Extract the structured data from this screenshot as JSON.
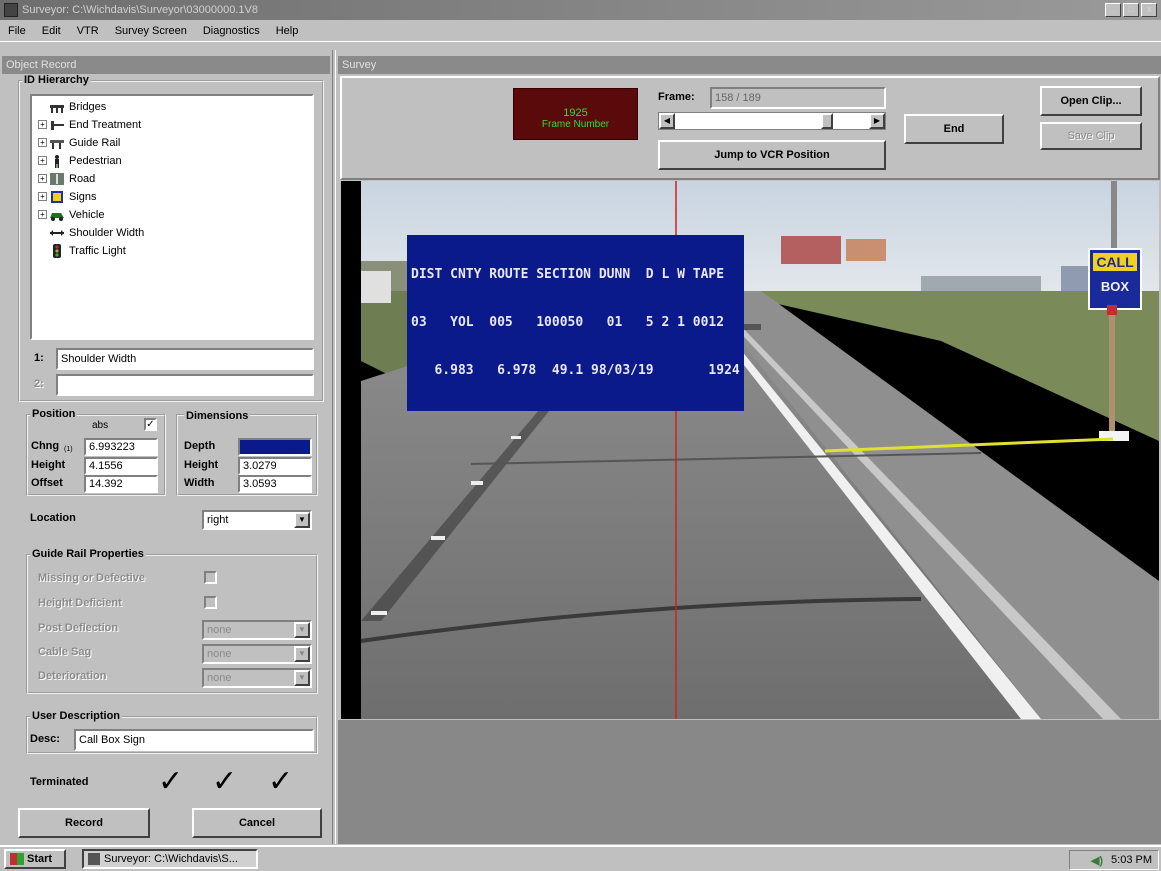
{
  "window": {
    "title": "Surveyor: C:\\Wichdavis\\Surveyor\\03000000.1V8",
    "min_label": "_",
    "max_label": "□",
    "close_label": "x"
  },
  "menu": [
    "File",
    "Edit",
    "VTR",
    "Survey Screen",
    "Diagnostics",
    "Help"
  ],
  "object_record": {
    "panel_title": "Object Record",
    "hierarchy_label": "ID Hierarchy",
    "tree": [
      {
        "expand": "",
        "icon": "bridge-icon",
        "label": "Bridges"
      },
      {
        "expand": "+",
        "icon": "end-treatment-icon",
        "label": "End Treatment"
      },
      {
        "expand": "+",
        "icon": "guide-rail-icon",
        "label": "Guide Rail"
      },
      {
        "expand": "+",
        "icon": "pedestrian-icon",
        "label": "Pedestrian"
      },
      {
        "expand": "+",
        "icon": "road-icon",
        "label": "Road"
      },
      {
        "expand": "+",
        "icon": "signs-icon",
        "label": "Signs"
      },
      {
        "expand": "+",
        "icon": "vehicle-icon",
        "label": "Vehicle"
      },
      {
        "expand": "",
        "icon": "shoulder-width-icon",
        "label": "Shoulder Width"
      },
      {
        "expand": "",
        "icon": "traffic-light-icon",
        "label": "Traffic Light"
      }
    ],
    "field1_label": "1:",
    "field1_value": "Shoulder Width",
    "field2_label": "2:",
    "field2_value": "",
    "position": {
      "title": "Position",
      "abs_label": "abs",
      "abs_checked": "✓",
      "chng_label": "Chng",
      "chng_sub": "(1)",
      "chng_value": "6.993223",
      "height_label": "Height",
      "height_value": "4.1556",
      "offset_label": "Offset",
      "offset_value": "14.392"
    },
    "dimensions": {
      "title": "Dimensions",
      "depth_label": "Depth",
      "depth_value": "",
      "height_label": "Height",
      "height_value": "3.0279",
      "width_label": "Width",
      "width_value": "3.0593"
    },
    "location_label": "Location",
    "location_value": "right",
    "guide_rail": {
      "title": "Guide Rail Properties",
      "missing_label": "Missing or Defective",
      "height_def_label": "Height Deficient",
      "post_def_label": "Post Deflection",
      "post_def_value": "none",
      "cable_sag_label": "Cable Sag",
      "cable_sag_value": "none",
      "deterioration_label": "Deterioration",
      "deterioration_value": "none"
    },
    "user_desc": {
      "title": "User Description",
      "desc_label": "Desc:",
      "desc_value": "Call Box Sign"
    },
    "terminated_label": "Terminated",
    "checks": [
      "✓",
      "✓",
      "✓"
    ],
    "record_button": "Record",
    "cancel_button": "Cancel"
  },
  "survey": {
    "panel_title": "Survey",
    "frame_display_number": "1925",
    "frame_display_caption": "Frame Number",
    "frame_label": "Frame:",
    "frame_value": "158 / 189",
    "frame_progress": 0.8,
    "jump_button": "Jump to VCR Position",
    "end_button": "End",
    "open_clip_button": "Open Clip...",
    "save_clip_button": "Save Clip",
    "osd_lines": [
      "DIST CNTY ROUTE SECTION DUNN  D L W TAPE",
      "03   YOL  005   100050   01   5 2 1 0012",
      "   6.983   6.978  49.1 98/03/19       1924"
    ],
    "sign_lines": [
      "CALL",
      "BOX"
    ]
  },
  "taskbar": {
    "start_label": "Start",
    "task_label": "Surveyor: C:\\Wichdavis\\S...",
    "clock": "5:03 PM"
  },
  "colors": {
    "desktop_gray": "#c0c0c0",
    "osd_blue": "#0a1a8a",
    "frame_display_bg": "#5a0a0a",
    "frame_display_text": "#33dd33",
    "measure_line": "#e0e030",
    "center_line": "#d02020"
  }
}
